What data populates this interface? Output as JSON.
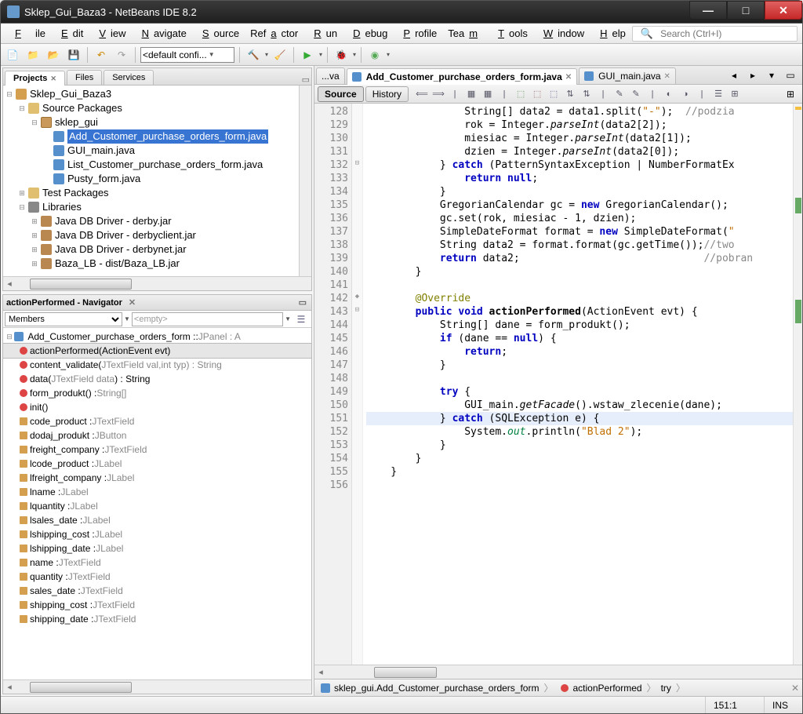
{
  "window": {
    "title": "Sklep_Gui_Baza3 - NetBeans IDE 8.2"
  },
  "menu": {
    "file": "File",
    "edit": "Edit",
    "view": "View",
    "navigate": "Navigate",
    "source": "Source",
    "refactor": "Refactor",
    "run": "Run",
    "debug": "Debug",
    "profile": "Profile",
    "team": "Team",
    "tools": "Tools",
    "window": "Window",
    "help": "Help"
  },
  "search": {
    "placeholder": "Search (Ctrl+I)"
  },
  "toolbar": {
    "config": "<default confi..."
  },
  "projects": {
    "tabs": {
      "projects": "Projects",
      "files": "Files",
      "services": "Services"
    },
    "root": "Sklep_Gui_Baza3",
    "srcpkg": "Source Packages",
    "pkg": "sklep_gui",
    "files": {
      "f1": "Add_Customer_purchase_orders_form.java",
      "f2": "GUI_main.java",
      "f3": "List_Customer_purchase_orders_form.java",
      "f4": "Pusty_form.java"
    },
    "testpkg": "Test Packages",
    "libs": "Libraries",
    "lib1": "Java DB Driver - derby.jar",
    "lib2": "Java DB Driver - derbyclient.jar",
    "lib3": "Java DB Driver - derbynet.jar",
    "lib4": "Baza_LB - dist/Baza_LB.jar"
  },
  "navigator": {
    "title": "actionPerformed - Navigator",
    "members": "Members",
    "empty": "<empty>",
    "class": "Add_Customer_purchase_orders_form :: ",
    "classtail": "JPanel : A",
    "m1": "actionPerformed(ActionEvent evt)",
    "m2": "content_validate(",
    "m2a": "JTextField val, ",
    "m2b": "int typ) : String",
    "m3": "data(",
    "m3a": "JTextField data",
    "m3b": ") : String",
    "m4": "form_produkt() : ",
    "m4a": "String[]",
    "m5": "init()",
    "f_code_product": "code_product : ",
    "t_jtf": "JTextField",
    "f_dodaj": "dodaj_produkt : ",
    "t_jb": "JButton",
    "f_freight": "freight_company : ",
    "f_lcode": "lcode_product : ",
    "t_jl": "JLabel",
    "f_lfreight": "lfreight_company : ",
    "f_lname": "lname : ",
    "f_lqty": "lquantity : ",
    "f_lsales": "lsales_date : ",
    "f_lshipc": "lshipping_cost : ",
    "f_lshipd": "lshipping_date : ",
    "f_name": "name : ",
    "f_qty": "quantity : ",
    "f_sales": "sales_date : ",
    "f_shipc": "shipping_cost : ",
    "f_shipd": "shipping_date : "
  },
  "editor": {
    "tab_trunc": "...va",
    "tab1": "Add_Customer_purchase_orders_form.java",
    "tab2": "GUI_main.java",
    "source": "Source",
    "history": "History"
  },
  "code": {
    "lines": [
      128,
      129,
      130,
      131,
      132,
      133,
      134,
      135,
      136,
      137,
      138,
      139,
      140,
      141,
      142,
      143,
      144,
      145,
      146,
      147,
      148,
      149,
      150,
      151,
      152,
      153,
      154,
      155,
      156
    ]
  },
  "breadcrumb": {
    "c1": "sklep_gui.Add_Customer_purchase_orders_form",
    "c2": "actionPerformed",
    "c3": "try"
  },
  "status": {
    "pos": "151:1",
    "ins": "INS"
  }
}
